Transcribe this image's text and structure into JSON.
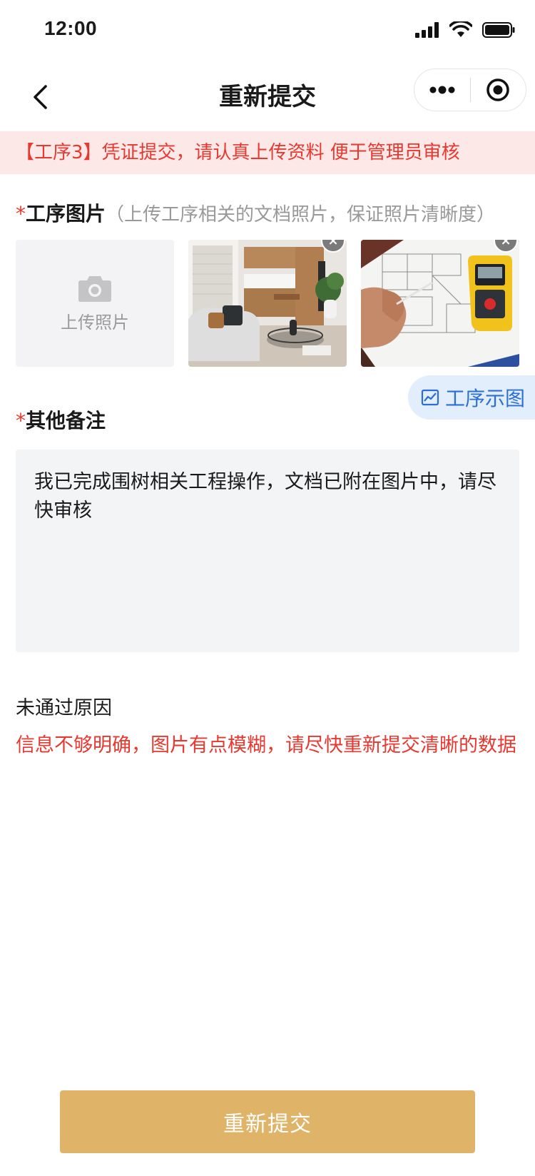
{
  "status_bar": {
    "time": "12:00"
  },
  "nav": {
    "title": "重新提交"
  },
  "notice": {
    "text": "【工序3】凭证提交，请认真上传资料  便于管理员审核"
  },
  "photos_section": {
    "required_mark": "*",
    "label": "工序图片",
    "hint": "（上传工序相关的文档照片，保证照片清晰度）",
    "upload_label": "上传照片",
    "remove_symbol": "×"
  },
  "example_button": {
    "label": "工序示图"
  },
  "notes_section": {
    "required_mark": "*",
    "label": "其他备注",
    "value": "我已完成围树相关工程操作，文档已附在图片中，请尽快审核"
  },
  "reject": {
    "title": "未通过原因",
    "reason": "信息不够明确，图片有点模糊，请尽快重新提交清晰的数据"
  },
  "submit": {
    "label": "重新提交"
  },
  "colors": {
    "accent_red": "#e8382f",
    "button_gold": "#dfb468",
    "link_blue": "#2a6fd6",
    "notice_bg": "#fde8e8"
  }
}
